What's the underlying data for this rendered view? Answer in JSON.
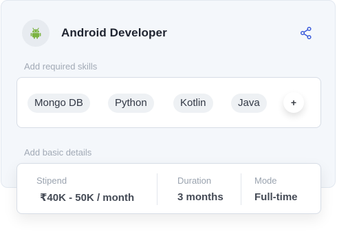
{
  "job": {
    "title": "Android Developer",
    "icon": "android-icon",
    "share_icon": "share-icon"
  },
  "skills": {
    "label": "Add required skills",
    "items": [
      "Mongo DB",
      "Python",
      "Kotlin",
      "Java"
    ],
    "add_label": "+"
  },
  "details": {
    "label": "Add basic details",
    "stipend": {
      "label": "Stipend",
      "value": "₹40K - 50K / month"
    },
    "duration": {
      "label": "Duration",
      "value": "3 months"
    },
    "mode": {
      "label": "Mode",
      "value": "Full-time"
    }
  },
  "colors": {
    "android": "#7cb342",
    "accent": "#3b5bdb"
  }
}
